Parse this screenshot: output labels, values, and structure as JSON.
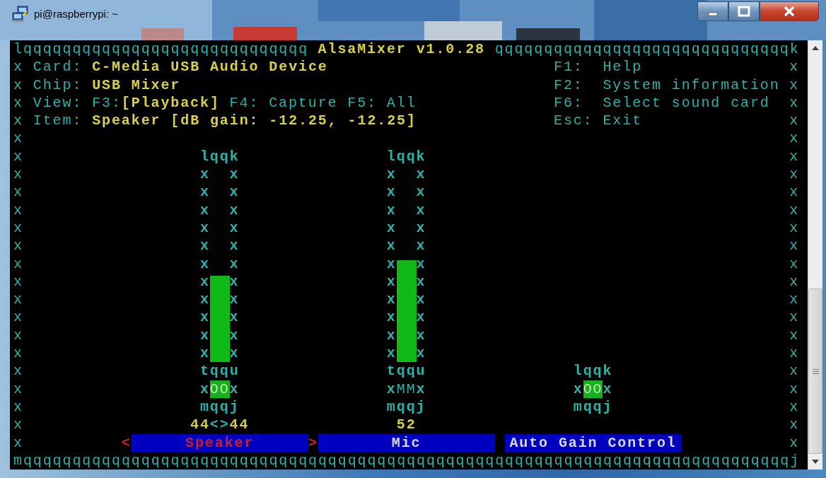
{
  "window": {
    "title": "pi@raspberrypi: ~"
  },
  "terminal": {
    "border_top_left": "lqqqqqqqqqqqqqqqqqqqqqqqqqqqqq",
    "title": "AlsaMixer v1.0.28",
    "border_top_right": "qqqqqqqqqqqqqqqqqqqqqqqqqqqqqqk",
    "left_edge": "xxxxxxxxxxxxxxxxxxxxxx",
    "right_edge": "xxxxxxxxxxxxxxxxxxxxxx",
    "border_bottom": "mqqqqqqqqqqqqqqqqqqqqqqqqqqqqqqqqqqqqqqqqqqqqqqqqqqqqqqqqqqqqqqqqqqqqqqqqqqqqqqj",
    "info": [
      {
        "label": "Card:",
        "value": "C-Media USB Audio Device"
      },
      {
        "label": "Chip:",
        "value": "USB Mixer"
      },
      {
        "label": "View:",
        "views": [
          {
            "key": "F3:",
            "name": "[Playback]",
            "selected": true
          },
          {
            "key": "F4:",
            "name": "Capture",
            "selected": false
          },
          {
            "key": "F5:",
            "name": "All",
            "selected": false
          }
        ]
      },
      {
        "label": "Item:",
        "value": "Speaker [dB gain: -12.25, -12.25]"
      }
    ],
    "help": [
      {
        "key": "F1:",
        "action": "Help"
      },
      {
        "key": "F2:",
        "action": "System information"
      },
      {
        "key": "F6:",
        "action": "Select sound card"
      },
      {
        "key": "Esc:",
        "action": "Exit"
      }
    ],
    "cursor": [
      "<",
      ">"
    ],
    "controls": [
      {
        "kind": "slider",
        "name": "Speaker",
        "selected": true,
        "level": 0.44,
        "frame_top": "lqqk",
        "rail_left": "xxxxxxxxxxx",
        "rail_right": "xxxxxxxxxxx",
        "frame_mid": "tqqu",
        "switch_left": "x",
        "switch": "OO",
        "switch_on": true,
        "switch_right": "x",
        "frame_bottom": "mqqj",
        "values": [
          "44",
          "44"
        ],
        "separator": "<>"
      },
      {
        "kind": "slider",
        "name": "Mic",
        "selected": false,
        "level": 0.52,
        "frame_top": "lqqk",
        "rail_left": "xxxxxxxxxxx",
        "rail_right": "xxxxxxxxxxx",
        "frame_mid": "tqqu",
        "switch_left": "x",
        "switch": "MM",
        "switch_on": false,
        "switch_right": "x",
        "frame_bottom": "mqqj",
        "values": [
          "52"
        ]
      },
      {
        "kind": "switch",
        "name": "Auto Gain Control",
        "selected": false,
        "frame_top": "lqqk",
        "switch_left": "x",
        "switch": "OO",
        "switch_on": true,
        "switch_right": "x",
        "frame_bottom": "mqqj"
      }
    ]
  }
}
